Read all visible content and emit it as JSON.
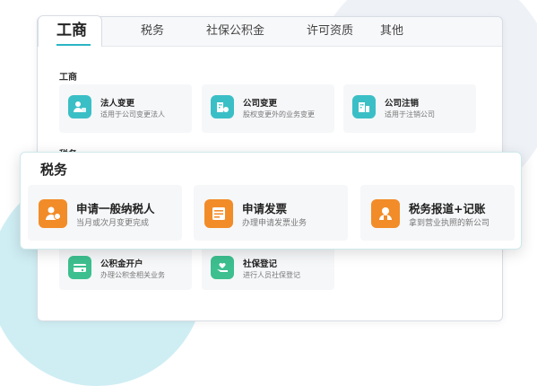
{
  "tabs": [
    "工商",
    "税务",
    "社保公积金",
    "许可资质",
    "其他"
  ],
  "sections": {
    "gongshang": {
      "title": "工商",
      "items": [
        {
          "title": "法人变更",
          "desc": "适用于公司变更法人",
          "icon": "person-card-icon",
          "color": "#3bbfc6"
        },
        {
          "title": "公司变更",
          "desc": "股权变更外的业务变更",
          "icon": "building-change-icon",
          "color": "#3bbfc6"
        },
        {
          "title": "公司注销",
          "desc": "适用于注销公司",
          "icon": "building-cancel-icon",
          "color": "#3bbfc6"
        }
      ]
    },
    "shuiwu_peek": {
      "title": "税务"
    },
    "shebao": {
      "items": [
        {
          "title": "公积金开户",
          "desc": "办理公积金相关业务",
          "icon": "fund-card-icon",
          "color": "#3dbf8f"
        },
        {
          "title": "社保登记",
          "desc": "进行人员社保登记",
          "icon": "hand-heart-icon",
          "color": "#3dbf8f"
        }
      ]
    }
  },
  "popup": {
    "title": "税务",
    "items": [
      {
        "title": "申请一般纳税人",
        "desc": "当月或次月变更完成",
        "icon": "taxpayer-icon",
        "color": "#f28c28"
      },
      {
        "title": "申请发票",
        "desc": "办理申请发票业务",
        "icon": "invoice-icon",
        "color": "#f28c28"
      },
      {
        "title": "税务报道+记账",
        "desc": "拿到营业执照的新公司",
        "icon": "tax-report-icon",
        "color": "#f28c28"
      }
    ]
  }
}
